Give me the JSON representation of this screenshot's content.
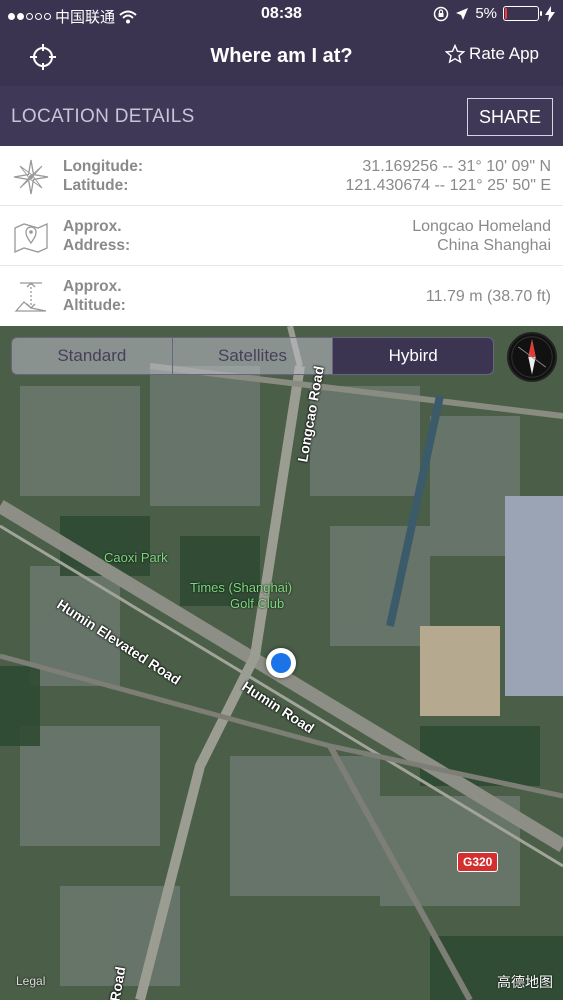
{
  "status_bar": {
    "carrier": "中国联通",
    "time": "08:38",
    "battery": "5%",
    "battery_level": 0.05
  },
  "nav": {
    "title": "Where am I at?",
    "rate_app": "Rate App"
  },
  "section": {
    "title": "LOCATION DETAILS",
    "share": "SHARE"
  },
  "details": {
    "coords": {
      "label1": "Longitude:",
      "label2": "Latitude:",
      "value1": "31.169256 -- 31° 10' 09\" N",
      "value2": "121.430674 -- 121° 25' 50\" E"
    },
    "address": {
      "label1": "Approx.",
      "label2": "Address:",
      "value1": "Longcao Homeland",
      "value2": "China Shanghai"
    },
    "altitude": {
      "label1": "Approx.",
      "label2": "Altitude:",
      "value": "11.79 m (38.70 ft)"
    }
  },
  "map": {
    "modes": [
      "Standard",
      "Satellites",
      "Hybird"
    ],
    "active_mode": "Hybird",
    "labels": {
      "longcao_road": "Longcao Road",
      "caoxi_park": "Caoxi Park",
      "golf_club_1": "Times (Shanghai)",
      "golf_club_2": "Golf Club",
      "humin_elevated": "Humin Elevated Road",
      "humin_road": "Humin Road",
      "road_bottom": "Road"
    },
    "highway_shield": "G320",
    "legal": "Legal",
    "brand": "高德地图"
  }
}
